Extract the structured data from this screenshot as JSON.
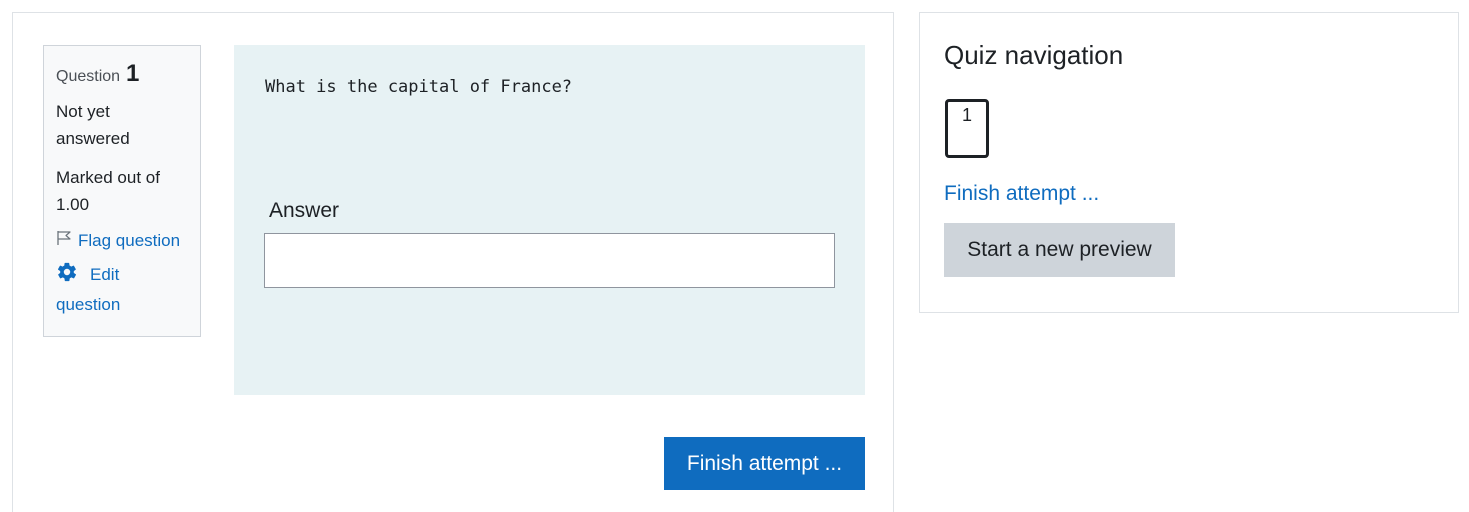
{
  "question_info": {
    "label": "Question",
    "number": "1",
    "state": "Not yet answered",
    "grade": "Marked out of 1.00",
    "flag_label": "Flag question",
    "edit_label": "Edit question"
  },
  "question": {
    "text": "What is the capital of France?",
    "answer_label": "Answer",
    "answer_value": "",
    "answer_placeholder": ""
  },
  "actions": {
    "finish_label": "Finish attempt ..."
  },
  "navigation": {
    "title": "Quiz navigation",
    "question_buttons": [
      "1"
    ],
    "finish_link": "Finish attempt ...",
    "new_preview_label": "Start a new preview"
  },
  "icons": {
    "flag": "flag-icon",
    "edit": "gear-icon"
  },
  "colors": {
    "link": "#0f6cbf",
    "primary_button": "#0f6cbf",
    "secondary_button": "#ced4da",
    "content_background": "#e7f2f4",
    "info_background": "#f8f9fa"
  }
}
